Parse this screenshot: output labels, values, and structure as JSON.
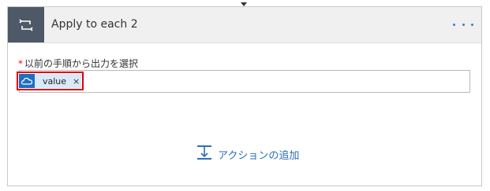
{
  "card": {
    "title": "Apply to each 2",
    "header_icon": "loop-icon",
    "more_icon": "ellipsis-icon"
  },
  "field": {
    "required_marker": "*",
    "label": "以前の手順から出力を選択",
    "token": {
      "icon": "onedrive-cloud-icon",
      "label": "value",
      "remove": "×"
    }
  },
  "add_action": {
    "icon": "add-step-icon",
    "label": "アクションの追加"
  },
  "colors": {
    "header_icon_bg": "#4d5966",
    "accent": "#2a6ebb",
    "highlight": "#e00000"
  }
}
